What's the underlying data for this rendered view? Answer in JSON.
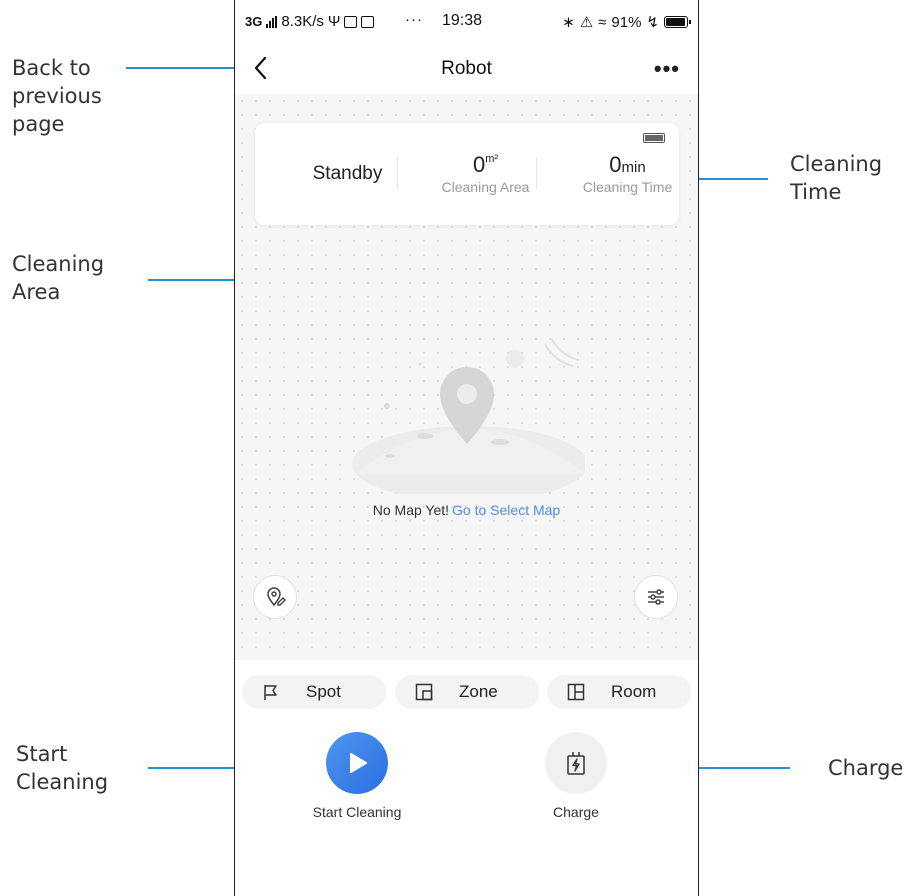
{
  "statusbar": {
    "network": "3G",
    "speed": "8.3K/s",
    "time": "19:38",
    "battery": "91%",
    "dots": "···"
  },
  "nav": {
    "title": "Robot",
    "more": "•••"
  },
  "card": {
    "state": "Standby",
    "area_value": "0",
    "area_unit": "m²",
    "area_label": "Cleaning Area",
    "time_value": "0",
    "time_unit": "min",
    "time_label": "Cleaning Time"
  },
  "map": {
    "empty_text": "No Map Yet!",
    "select_link": "Go to Select Map"
  },
  "modes": [
    {
      "label": "Spot",
      "icon": "flag-icon"
    },
    {
      "label": "Zone",
      "icon": "zone-icon"
    },
    {
      "label": "Room",
      "icon": "room-icon"
    }
  ],
  "actions": {
    "start_label": "Start Cleaning",
    "start_icon": "play-icon",
    "charge_label": "Charge",
    "charge_icon": "charging-plug-icon"
  },
  "annotations": {
    "back": "Back to previous page",
    "area": "Cleaning Area",
    "time": "Cleaning Time",
    "start": "Start Cleaning",
    "charge": "Charge"
  },
  "colors": {
    "accent": "#2f7be6",
    "link": "#4a8ee0",
    "annotation": "#2a8fc9"
  }
}
